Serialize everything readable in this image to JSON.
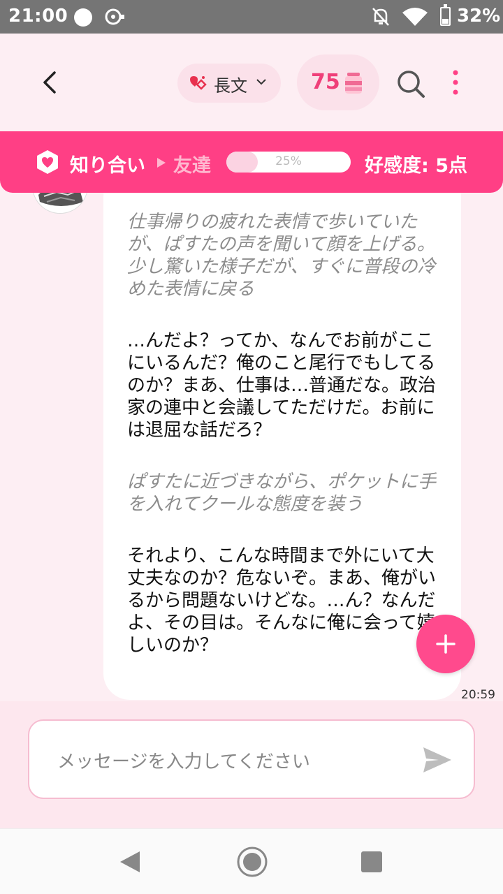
{
  "status_bar": {
    "time": "21:00",
    "battery": "32%",
    "battery_level": 0.32
  },
  "header": {
    "mode_label": "長文",
    "points": "75",
    "icons": [
      "back-arrow-icon",
      "heart-link-icon",
      "chevron-down-icon",
      "jar-icon",
      "search-icon",
      "more-vertical-icon"
    ]
  },
  "relationship": {
    "current_level": "知り合い",
    "next_level": "友達",
    "progress_label": "25%",
    "progress": 0.25,
    "score_label": "好感度: 5点"
  },
  "message": {
    "paragraphs": [
      {
        "type": "narration",
        "text": "仕事帰りの疲れた表情で歩いていたが、ぱすたの声を聞いて顔を上げる。少し驚いた様子だが、すぐに普段の冷めた表情に戻る"
      },
      {
        "type": "speech",
        "text": "…んだよ？ってか、なんでお前がここにいるんだ？俺のこと尾行でもしてるのか？まあ、仕事は…普通だな。政治家の連中と会議してただけだ。お前には退屈な話だろ？"
      },
      {
        "type": "narration",
        "text": "ぱすたに近づきながら、ポケットに手を入れてクールな態度を装う"
      },
      {
        "type": "speech",
        "text": "それより、こんな時間まで外にいて大丈夫なのか？危ないぞ。まあ、俺がいるから問題ないけどな。…ん？なんだよ、その目は。そんなに俺に会って嬉しいのか？"
      }
    ],
    "time": "20:59"
  },
  "input": {
    "placeholder": "メッセージを入力してください"
  },
  "colors": {
    "accent": "#ff3f85",
    "header_bg": "#fdeef3",
    "points": "#ef3f79"
  }
}
